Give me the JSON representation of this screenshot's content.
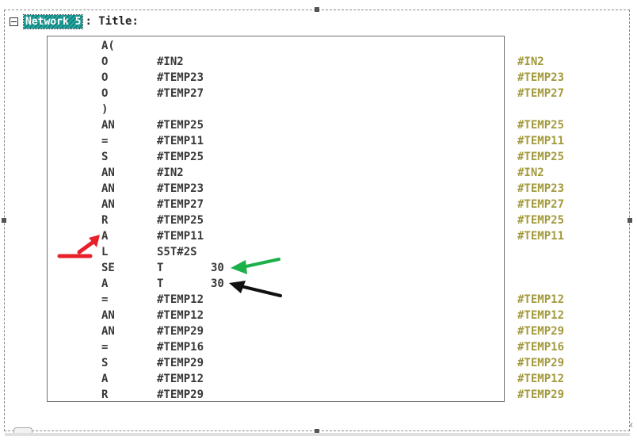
{
  "network": {
    "label": "Network 5",
    "title": ": Title:"
  },
  "lines": [
    {
      "op": "A(",
      "operand": "",
      "num": "",
      "comment": ""
    },
    {
      "op": "O",
      "operand": "#IN2",
      "num": "",
      "comment": "#IN2"
    },
    {
      "op": "O",
      "operand": "#TEMP23",
      "num": "",
      "comment": "#TEMP23"
    },
    {
      "op": "O",
      "operand": "#TEMP27",
      "num": "",
      "comment": "#TEMP27"
    },
    {
      "op": ")",
      "operand": "",
      "num": "",
      "comment": ""
    },
    {
      "op": "AN",
      "operand": "#TEMP25",
      "num": "",
      "comment": "#TEMP25"
    },
    {
      "op": "=",
      "operand": "#TEMP11",
      "num": "",
      "comment": "#TEMP11"
    },
    {
      "op": "S",
      "operand": "#TEMP25",
      "num": "",
      "comment": "#TEMP25"
    },
    {
      "op": "AN",
      "operand": "#IN2",
      "num": "",
      "comment": "#IN2"
    },
    {
      "op": "AN",
      "operand": "#TEMP23",
      "num": "",
      "comment": "#TEMP23"
    },
    {
      "op": "AN",
      "operand": "#TEMP27",
      "num": "",
      "comment": "#TEMP27"
    },
    {
      "op": "R",
      "operand": "#TEMP25",
      "num": "",
      "comment": "#TEMP25"
    },
    {
      "op": "A",
      "operand": "#TEMP11",
      "num": "",
      "comment": "#TEMP11"
    },
    {
      "op": "L",
      "operand": "S5T#2S",
      "num": "",
      "comment": ""
    },
    {
      "op": "SE",
      "operand": "T",
      "num": "30",
      "comment": ""
    },
    {
      "op": "A",
      "operand": "T",
      "num": "30",
      "comment": ""
    },
    {
      "op": "=",
      "operand": "#TEMP12",
      "num": "",
      "comment": "#TEMP12"
    },
    {
      "op": "AN",
      "operand": "#TEMP12",
      "num": "",
      "comment": "#TEMP12"
    },
    {
      "op": "AN",
      "operand": "#TEMP29",
      "num": "",
      "comment": "#TEMP29"
    },
    {
      "op": "=",
      "operand": "#TEMP16",
      "num": "",
      "comment": "#TEMP16"
    },
    {
      "op": "S",
      "operand": "#TEMP29",
      "num": "",
      "comment": "#TEMP29"
    },
    {
      "op": "A",
      "operand": "#TEMP12",
      "num": "",
      "comment": "#TEMP12"
    },
    {
      "op": "R",
      "operand": "#TEMP29",
      "num": "",
      "comment": "#TEMP29"
    }
  ],
  "annotations": [
    {
      "icon": "red-arrow-icon",
      "color": "#e8202a",
      "points_to": "L"
    },
    {
      "icon": "green-arrow-icon",
      "color": "#1bb04a",
      "points_to": "SE T 30"
    },
    {
      "icon": "black-arrow-icon",
      "color": "#111111",
      "points_to": "A T 30"
    }
  ],
  "colors": {
    "code_text": "#383838",
    "comment_text": "#a39a3c",
    "network_label_bg": "#0f8580"
  }
}
